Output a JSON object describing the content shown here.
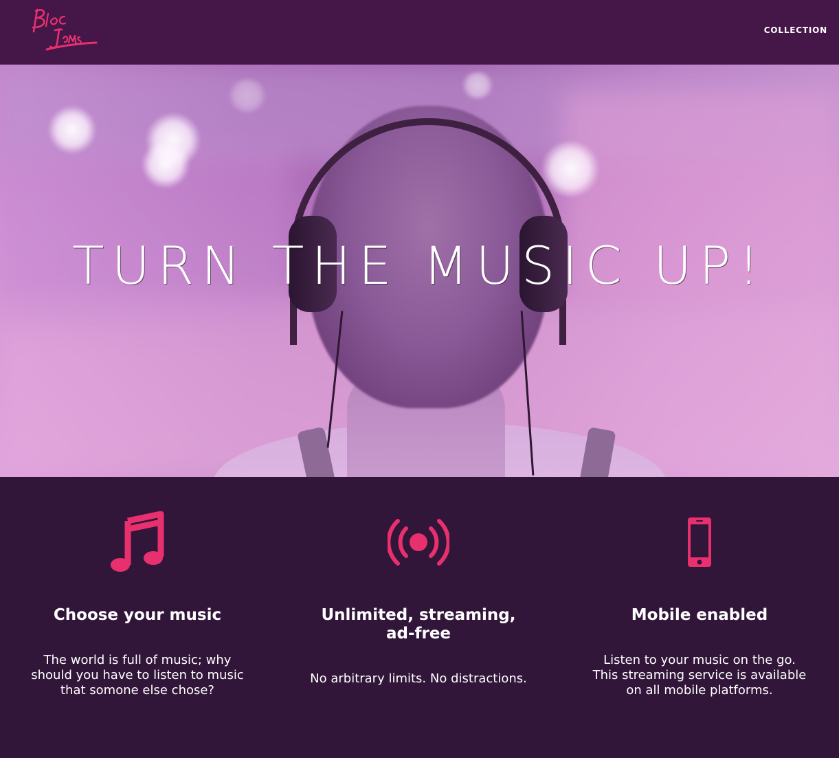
{
  "brand": {
    "name": "Bloc Jams",
    "accent_color": "#e8306f"
  },
  "nav": {
    "collection_label": "COLLECTION"
  },
  "hero": {
    "title": "TURN THE MUSIC UP!"
  },
  "selling_points": [
    {
      "icon": "music-note-icon",
      "title": "Choose your music",
      "description": "The world is full of music; why should you have to listen to music that somone else chose?"
    },
    {
      "icon": "broadcast-icon",
      "title": "Unlimited, streaming, ad-free",
      "description": "No arbitrary limits. No distractions."
    },
    {
      "icon": "mobile-phone-icon",
      "title": "Mobile enabled",
      "description": "Listen to your music on the go. This streaming service is available on all mobile platforms."
    }
  ]
}
